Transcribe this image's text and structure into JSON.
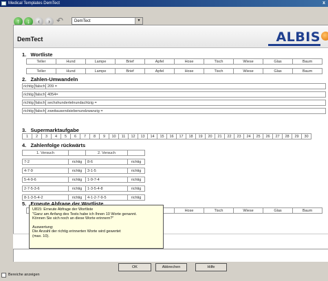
{
  "window": {
    "title": "Medical Templates DemTect",
    "close_glyph": "x"
  },
  "toolbar": {
    "template_select": "DemTect"
  },
  "app_title": "DemTect",
  "logo": "ALBIS",
  "sections": {
    "s1": {
      "num": "1.",
      "title": "Wortliste"
    },
    "s2": {
      "num": "2.",
      "title": "Zahlen-Umwandeln"
    },
    "s3": {
      "num": "3.",
      "title": "Supermarktaufgabe"
    },
    "s4": {
      "num": "4.",
      "title": "Zahlenfolge rückwärts"
    },
    "s5": {
      "num": "5.",
      "title": "Erneute Abfrage der Wortliste"
    }
  },
  "wordlist": [
    "Teller",
    "Hund",
    "Lampe",
    "Brief",
    "Apfel",
    "Hose",
    "Tisch",
    "Wiese",
    "Glas",
    "Baum"
  ],
  "zahlen": {
    "richtig": "richtig",
    "falsch": "falsch",
    "items": [
      "209 =",
      "4054=",
      "sechshundertelnundachtzig =",
      "zweitausendsiebenundzwanzig ="
    ]
  },
  "supermarkt_numbers": [
    "1",
    "2",
    "3",
    "4",
    "5",
    "6",
    "7",
    "8",
    "9",
    "10",
    "11",
    "12",
    "13",
    "14",
    "15",
    "16",
    "17",
    "18",
    "19",
    "20",
    "21",
    "22",
    "23",
    "24",
    "25",
    "26",
    "27",
    "28",
    "29",
    "30"
  ],
  "zahlenfolge": {
    "col1": "1. Versuch",
    "col2": "2. Versuch",
    "rows": [
      {
        "a": "7-2",
        "b": "richtig",
        "c": "8-6",
        "d": "richtig"
      },
      {
        "a": "4-7-9",
        "b": "richtig",
        "c": "3-1-5",
        "d": "richtig"
      },
      {
        "a": "5-4-9-6",
        "b": "richtig",
        "c": "1-9-7-4",
        "d": "richtig"
      },
      {
        "a": "2-7-5-3-6",
        "b": "richtig",
        "c": "1-3-5-4-8",
        "d": "richtig"
      },
      {
        "a": "8-1-3-5-4-2",
        "b": "richtig",
        "c": "4-1-2-7-9-5",
        "d": "richtig"
      }
    ]
  },
  "tooltip": {
    "lines": [
      "U815: Erneute Abfrage der Wortliste",
      "\"Ganz am Anfang des Tests habe ich Ihnen 10 Worte genannt.",
      "Können Sie sich noch an diese Worte erinnern?\"",
      "",
      "Auswertung:",
      "Die Anzahl der richtig erinnerten Worte wird gewertet",
      "(max. 10)."
    ]
  },
  "buttons": {
    "ok": "OK",
    "cancel": "Abbrechen",
    "help": "Hilfe"
  },
  "footer": {
    "checkbox_label": "Bereiche anzeigen"
  }
}
